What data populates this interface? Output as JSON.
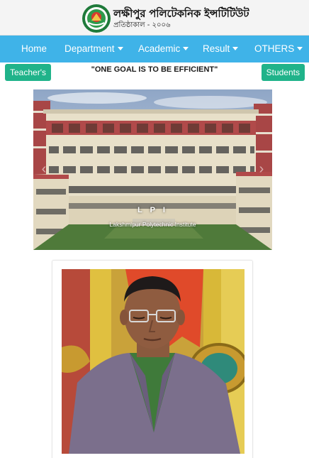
{
  "header": {
    "title": "লক্ষীপুর পলিটেকনিক ইন্সটিটিউট",
    "subtitle": "প্রতিষ্ঠাকাল - ২০০৬",
    "logo_icon": "institute-seal-icon"
  },
  "nav": {
    "items": [
      {
        "label": "Home",
        "dropdown": false
      },
      {
        "label": "Department",
        "dropdown": true
      },
      {
        "label": "Academic",
        "dropdown": true
      },
      {
        "label": "Result",
        "dropdown": true
      },
      {
        "label": "OTHERS",
        "dropdown": true
      }
    ]
  },
  "actions": {
    "teachers_label": "Teacher's",
    "students_label": "Students"
  },
  "slogan": "\"ONE GOAL IS TO BE EFFICIENT\"",
  "carousel": {
    "caption_title": "L P I",
    "caption_subtitle": "Lakshmipur Polytechnic Institute"
  },
  "colors": {
    "nav_bg": "#3fb3e8",
    "button_bg": "#20b38a",
    "building_red": "#b14a4a"
  }
}
